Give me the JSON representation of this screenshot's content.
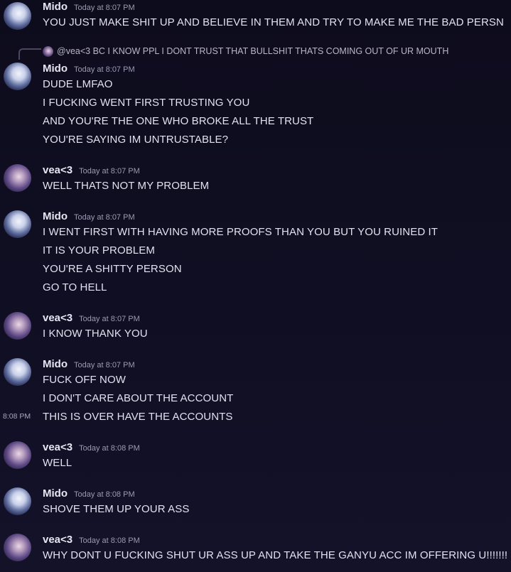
{
  "messages": [
    {
      "author": "Mido",
      "timestamp": "Today at 8:07 PM",
      "lines": [
        "YOU JUST MAKE SHIT UP AND BELIEVE IN THEM AND TRY TO MAKE ME THE BAD PERSN"
      ]
    },
    {
      "reply": {
        "mention": "@vea<3",
        "text": "BC I KNOW PPL I DONT TRUST THAT BULLSHIT THATS COMING OUT OF UR MOUTH"
      },
      "author": "Mido",
      "timestamp": "Today at 8:07 PM",
      "lines": [
        "DUDE LMFAO",
        "I FUCKING WENT FIRST TRUSTING YOU",
        "AND YOU'RE THE ONE WHO BROKE ALL THE TRUST",
        "YOU'RE SAYING IM UNTRUSTABLE?"
      ]
    },
    {
      "author": "vea<3",
      "timestamp": "Today at 8:07 PM",
      "lines": [
        "WELL THATS NOT MY PROBLEM"
      ]
    },
    {
      "author": "Mido",
      "timestamp": "Today at 8:07 PM",
      "lines": [
        "I WENT FIRST WITH HAVING MORE PROOFS THAN YOU BUT YOU RUINED IT",
        "IT IS YOUR PROBLEM",
        "YOU'RE A SHITTY PERSON",
        "GO TO HELL"
      ]
    },
    {
      "author": "vea<3",
      "timestamp": "Today at 8:07 PM",
      "lines": [
        "I KNOW THANK YOU"
      ]
    },
    {
      "author": "Mido",
      "timestamp": "Today at 8:07 PM",
      "lines": [
        "FUCK OFF NOW",
        "I DON'T CARE ABOUT THE ACCOUNT",
        "THIS IS OVER HAVE THE ACCOUNTS"
      ],
      "hover_time": "8:08 PM"
    },
    {
      "author": "vea<3",
      "timestamp": "Today at 8:08 PM",
      "lines": [
        "WELL"
      ]
    },
    {
      "author": "Mido",
      "timestamp": "Today at 8:08 PM",
      "lines": [
        "SHOVE THEM UP YOUR ASS"
      ]
    },
    {
      "author": "vea<3",
      "timestamp": "Today at 8:08 PM",
      "lines": [
        "WHY DONT U FUCKING SHUT UR ASS UP AND TAKE THE GANYU ACC IM OFFERING U!!!!!!!"
      ]
    }
  ]
}
